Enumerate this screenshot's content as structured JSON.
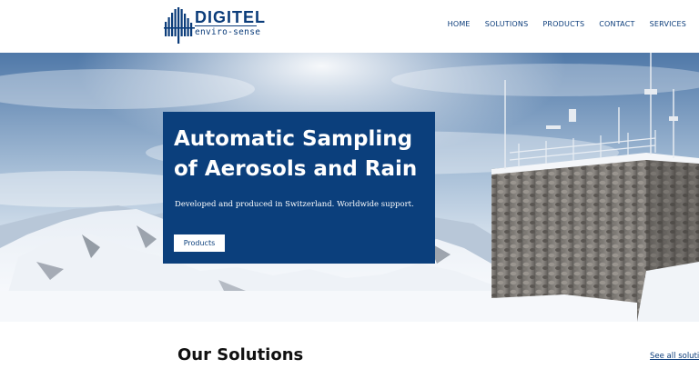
{
  "header": {
    "logo": {
      "name": "DIGITEL",
      "tagline": "enviro-sense"
    },
    "nav": [
      "HOME",
      "SOLUTIONS",
      "PRODUCTS",
      "CONTACT",
      "SERVICES"
    ]
  },
  "hero": {
    "title": "Automatic Sampling of Aerosols and Rain",
    "subtitle": "Developed and produced in Switzerland. Worldwide support.",
    "button_label": "Products"
  },
  "solutions": {
    "title": "Our Solutions",
    "link_label": "See all solutions"
  },
  "colors": {
    "brand_blue": "#0b3f7c",
    "background": "#ffffff",
    "title_text": "#111111"
  },
  "icons": [
    "digitel-logo-icon"
  ]
}
